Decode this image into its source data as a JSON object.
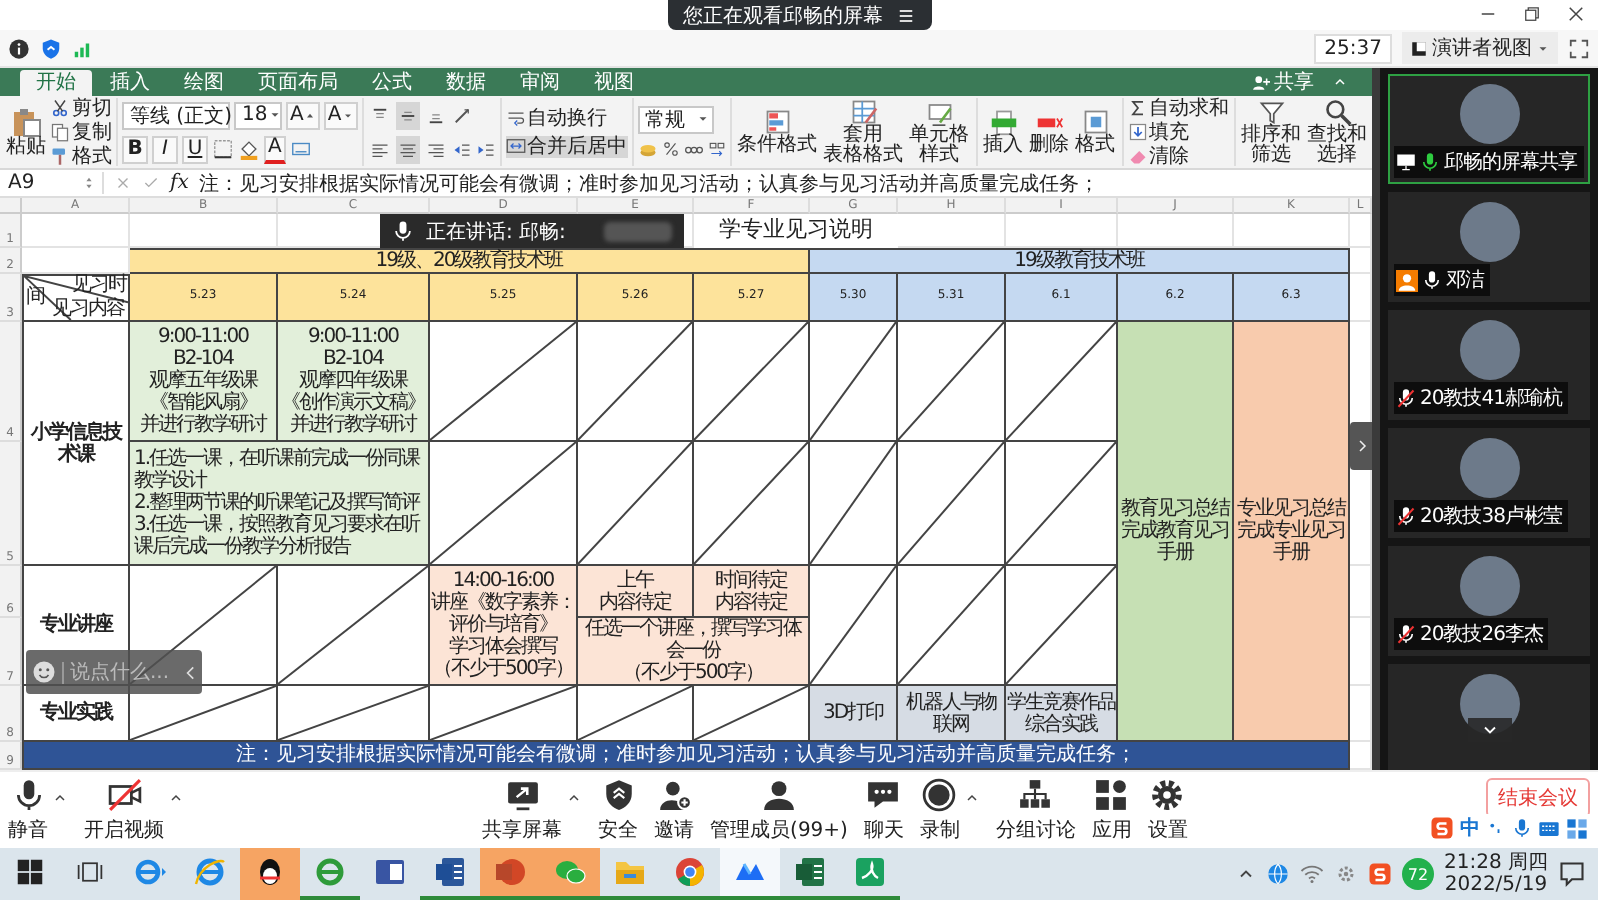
{
  "share_banner": {
    "title": "您正在观看邱畅的屏幕"
  },
  "meeting_header": {
    "timer": "25:37",
    "view_button": "演讲者视图"
  },
  "excel": {
    "tabs": [
      {
        "label": "开始",
        "selected": true
      },
      {
        "label": "插入",
        "selected": false
      },
      {
        "label": "绘图",
        "selected": false
      },
      {
        "label": "页面布局",
        "selected": false
      },
      {
        "label": "公式",
        "selected": false
      },
      {
        "label": "数据",
        "selected": false
      },
      {
        "label": "审阅",
        "selected": false
      },
      {
        "label": "视图",
        "selected": false
      }
    ],
    "share_button": "共享",
    "ribbon": {
      "paste": "粘贴",
      "clipboard": [
        {
          "label": "剪切",
          "kind": "cut"
        },
        {
          "label": "复制",
          "kind": "copy"
        },
        {
          "label": "格式",
          "kind": "painter"
        }
      ],
      "font": "等线 (正文)",
      "size": "18",
      "size_buttons": [
        {
          "label": "A",
          "kind": "grow"
        },
        {
          "label": "A",
          "kind": "shrink"
        }
      ],
      "style_buttons": [
        {
          "label": "B",
          "kind": "bold"
        },
        {
          "label": "I",
          "kind": "italic"
        },
        {
          "label": "U",
          "kind": "underline"
        }
      ],
      "font_color": "A",
      "vertical_align": [
        {
          "kind": "top",
          "selected": false
        },
        {
          "kind": "middle",
          "selected": true
        },
        {
          "kind": "bottom",
          "selected": false
        }
      ],
      "horizontal_align": [
        {
          "kind": "left",
          "selected": false
        },
        {
          "kind": "center",
          "selected": true
        },
        {
          "kind": "right",
          "selected": false
        }
      ],
      "wrap": {
        "label": "自动换行",
        "selected": false
      },
      "merge": {
        "label": "合并后居中",
        "selected": true
      },
      "number_format": "常规",
      "style_commands": [
        {
          "lines": [
            "条件格式"
          ],
          "kind": "conditional"
        },
        {
          "lines": [
            "套用",
            "表格格式"
          ],
          "kind": "table"
        },
        {
          "lines": [
            "单元格",
            "样式"
          ],
          "kind": "cell_style"
        }
      ],
      "cell_commands": [
        {
          "lines": [
            "插入"
          ],
          "kind": "insert"
        },
        {
          "lines": [
            "删除"
          ],
          "kind": "delete"
        },
        {
          "lines": [
            "格式"
          ],
          "kind": "format"
        }
      ],
      "editing": [
        {
          "label": "自动求和",
          "kind": "sum"
        },
        {
          "label": "填充",
          "kind": "fill"
        },
        {
          "label": "清除",
          "kind": "clear"
        }
      ],
      "find_commands": [
        {
          "lines": [
            "排序和",
            "筛选"
          ],
          "kind": "sort"
        },
        {
          "lines": [
            "查找和",
            "选择"
          ],
          "kind": "find"
        }
      ]
    },
    "formula_bar": {
      "name_box": "A9",
      "function_label": "fx",
      "formula": "注：见习安排根据实际情况可能会有微调；准时参加见习活动；认真参与见习活动并高质量完成任务；"
    },
    "sheet": {
      "columns": [
        "A",
        "B",
        "C",
        "D",
        "E",
        "F",
        "G",
        "H",
        "I",
        "J",
        "K",
        "L"
      ],
      "row_numbers": [
        "1",
        "2",
        "3",
        "4",
        "5",
        "6",
        "7",
        "8",
        "9"
      ],
      "cells": [
        {
          "kind": "title",
          "text": "学专业见习说明"
        },
        {
          "kind": "header",
          "text": "19级、20级教育技术班",
          "color": "#fde39b"
        },
        {
          "kind": "header",
          "text": "19级教育技术班",
          "color": "#c5d9f1"
        },
        {
          "kind": "corner",
          "labels": [
            "见习时",
            "间",
            "见习内容"
          ]
        },
        {
          "kind": "date",
          "text": "5.23",
          "color": "#fde39b"
        },
        {
          "kind": "date",
          "text": "5.24",
          "color": "#fde39b"
        },
        {
          "kind": "date",
          "text": "5.25",
          "color": "#fde39b"
        },
        {
          "kind": "date",
          "text": "5.26",
          "color": "#fde39b"
        },
        {
          "kind": "date",
          "text": "5.27",
          "color": "#fde39b"
        },
        {
          "kind": "date",
          "text": "5.30",
          "color": "#c5d9f1"
        },
        {
          "kind": "date",
          "text": "5.31",
          "color": "#c5d9f1"
        },
        {
          "kind": "date",
          "text": "6.1",
          "color": "#c5d9f1"
        },
        {
          "kind": "date",
          "text": "6.2",
          "color": "#c5d9f1"
        },
        {
          "kind": "date",
          "text": "6.3",
          "color": "#c5d9f1"
        },
        {
          "kind": "label",
          "text": "小学信息技术课"
        },
        {
          "kind": "text",
          "lines": [
            "9:00-11:00",
            "B2-104",
            "观摩五年级课",
            "《智能风扇》",
            "并进行教学研讨"
          ],
          "color": "#e2efda"
        },
        {
          "kind": "text",
          "lines": [
            "9:00-11:00",
            "B2-104",
            "观摩四年级课",
            "《创作演示文稿》",
            "并进行教学研讨"
          ],
          "color": "#e2efda"
        },
        {
          "kind": "diagonal"
        },
        {
          "kind": "diagonal"
        },
        {
          "kind": "diagonal"
        },
        {
          "kind": "diagonal"
        },
        {
          "kind": "diagonal"
        },
        {
          "kind": "diagonal"
        },
        {
          "kind": "list",
          "lines": [
            "1.任选一课，在听课前完成一份同课教学设计",
            "2.整理两节课的听课笔记及撰写简评",
            "3.任选一课，按照教育见习要求在听课后完成一份教学分析报告"
          ],
          "color": "#e2efda"
        },
        {
          "kind": "diagonal"
        },
        {
          "kind": "diagonal"
        },
        {
          "kind": "diagonal"
        },
        {
          "kind": "diagonal"
        },
        {
          "kind": "diagonal"
        },
        {
          "kind": "diagonal"
        },
        {
          "kind": "label",
          "text": "专业讲座"
        },
        {
          "kind": "diagonal"
        },
        {
          "kind": "diagonal"
        },
        {
          "kind": "text",
          "lines": [
            "14:00-16:00",
            "讲座《数字素养：",
            "评价与培育》",
            "学习体会撰写",
            "（不少于500字）"
          ],
          "color": "#fce4d6"
        },
        {
          "kind": "text",
          "lines": [
            "上午",
            "内容待定"
          ],
          "color": "#fce4d6"
        },
        {
          "kind": "text",
          "lines": [
            "时间待定",
            "内容待定"
          ],
          "color": "#fce4d6"
        },
        {
          "kind": "text",
          "lines": [
            "任选一个讲座，撰写学习体会一份",
            "（不少于500字）"
          ],
          "color": "#fce4d6"
        },
        {
          "kind": "diagonal"
        },
        {
          "kind": "diagonal"
        },
        {
          "kind": "diagonal"
        },
        {
          "kind": "label",
          "text": "专业实践"
        },
        {
          "kind": "diagonal"
        },
        {
          "kind": "diagonal"
        },
        {
          "kind": "diagonal"
        },
        {
          "kind": "diagonal"
        },
        {
          "kind": "diagonal"
        },
        {
          "kind": "text",
          "text": "3D打印",
          "color": "#d6dce4"
        },
        {
          "kind": "text",
          "text": "机器人与物联网",
          "color": "#d6dce4"
        },
        {
          "kind": "text",
          "lines": [
            "学生竞赛作品",
            "综合实践"
          ],
          "color": "#d6dce4"
        },
        {
          "kind": "text",
          "lines": [
            "教育见习总结",
            "完成教育见习",
            "手册"
          ],
          "color": "#c6e0b4"
        },
        {
          "kind": "text",
          "lines": [
            "专业见习总结",
            "完成专业见习",
            "手册"
          ],
          "color": "#f8cbad"
        },
        {
          "kind": "note",
          "text": "注：见习安排根据实际情况可能会有微调；准时参加见习活动；认真参与见习活动并高质量完成任务；",
          "color": "#2f5496"
        }
      ]
    }
  },
  "speaking_indicator": {
    "text": "正在讲话: 邱畅:"
  },
  "chat_input": {
    "placeholder": "说点什么..."
  },
  "participants": [
    {
      "name": "邱畅的屏幕共享",
      "kind": "screen_share",
      "speaking": true,
      "muted": false,
      "host": false
    },
    {
      "name": "邓洁",
      "kind": "person",
      "speaking": false,
      "muted": false,
      "host": true
    },
    {
      "name": "20教技41郝瑜杭",
      "kind": "person",
      "speaking": false,
      "muted": true,
      "host": false
    },
    {
      "name": "20教技38卢彬莹",
      "kind": "person",
      "speaking": false,
      "muted": true,
      "host": false
    },
    {
      "name": "20教技26李杰",
      "kind": "person",
      "speaking": false,
      "muted": true,
      "host": false
    }
  ],
  "toolbar": {
    "media": [
      {
        "label": "静音",
        "kind": "mic",
        "caret": true
      },
      {
        "label": "开启视频",
        "kind": "video_off",
        "caret": true
      }
    ],
    "items": [
      {
        "label": "共享屏幕",
        "kind": "share",
        "caret": true
      },
      {
        "label": "安全",
        "kind": "security",
        "caret": false
      },
      {
        "label": "邀请",
        "kind": "invite",
        "caret": false
      },
      {
        "label": "管理成员(99+)",
        "kind": "members",
        "caret": false
      },
      {
        "label": "聊天",
        "kind": "chat",
        "caret": false
      },
      {
        "label": "录制",
        "kind": "record",
        "caret": true
      },
      {
        "label": "分组讨论",
        "kind": "breakout",
        "caret": false
      },
      {
        "label": "应用",
        "kind": "apps",
        "caret": false
      },
      {
        "label": "设置",
        "kind": "settings",
        "caret": false
      }
    ],
    "end_button": "结束会议"
  },
  "ime_bar": {
    "mode": "中"
  },
  "taskbar": {
    "apps": [
      {
        "kind": "ie_arrow",
        "running": false,
        "flashing": false,
        "active": false
      },
      {
        "kind": "ie",
        "running": false,
        "flashing": false,
        "active": false
      },
      {
        "kind": "qq",
        "running": false,
        "flashing": true,
        "active": false
      },
      {
        "kind": "browser_green",
        "running": true,
        "flashing": false,
        "active": false
      },
      {
        "kind": "visio",
        "running": false,
        "flashing": false,
        "active": false
      },
      {
        "kind": "word",
        "running": true,
        "flashing": false,
        "active": false
      },
      {
        "kind": "powerpoint",
        "running": true,
        "flashing": true,
        "active": false
      },
      {
        "kind": "wechat",
        "running": true,
        "flashing": true,
        "active": false
      },
      {
        "kind": "explorer",
        "running": true,
        "flashing": false,
        "active": false
      },
      {
        "kind": "chrome",
        "running": true,
        "flashing": false,
        "active": false
      },
      {
        "kind": "meeting",
        "running": true,
        "flashing": false,
        "active": true
      },
      {
        "kind": "excel",
        "running": true,
        "flashing": false,
        "active": false
      },
      {
        "kind": "pdf",
        "running": true,
        "flashing": false,
        "active": false
      }
    ],
    "tray": {
      "badge": "72",
      "time": "21:28 周四",
      "date": "2022/5/19"
    }
  }
}
